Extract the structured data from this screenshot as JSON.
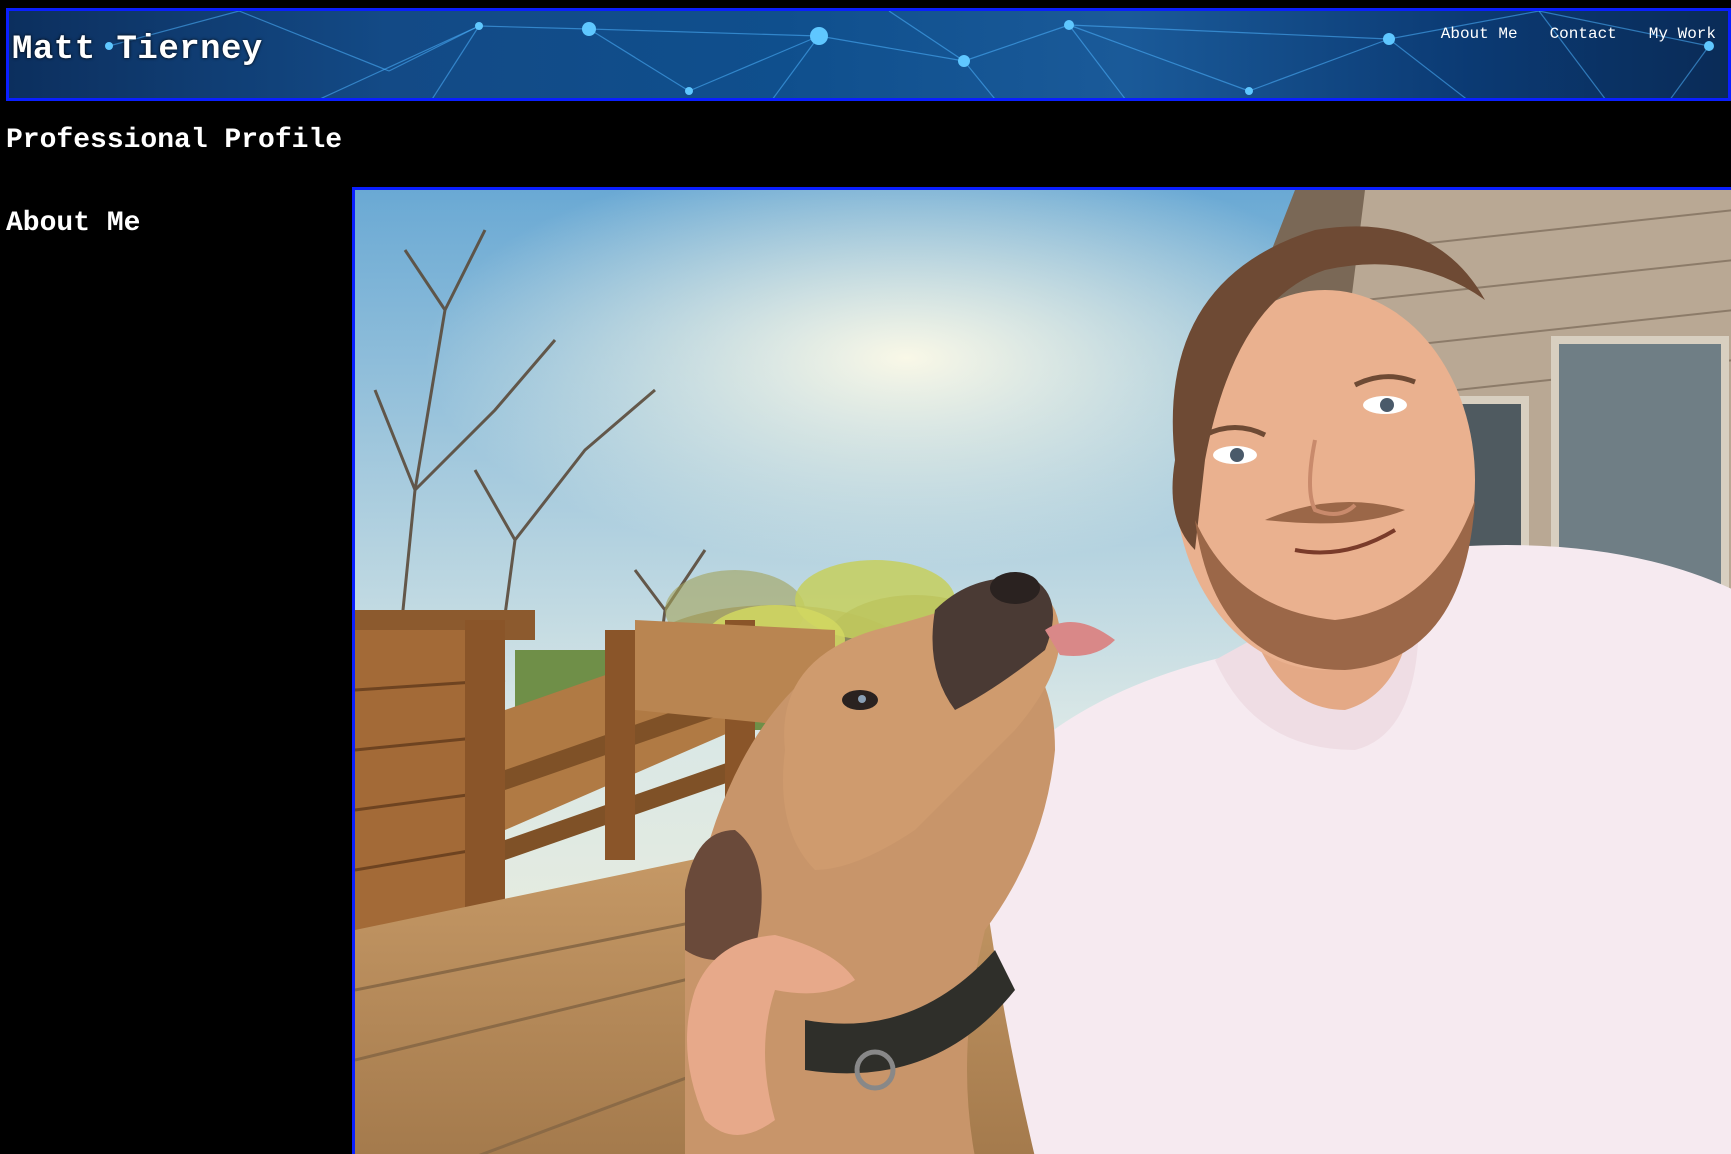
{
  "header": {
    "site_title": "Matt Tierney",
    "nav": [
      {
        "label": "About Me"
      },
      {
        "label": "Contact"
      },
      {
        "label": "My Work"
      }
    ]
  },
  "main": {
    "page_title": "Professional Profile",
    "section_title": "About Me"
  },
  "colors": {
    "background": "#000000",
    "border_accent": "#0a1fff",
    "header_blue": "#134a86",
    "text": "#ffffff"
  }
}
